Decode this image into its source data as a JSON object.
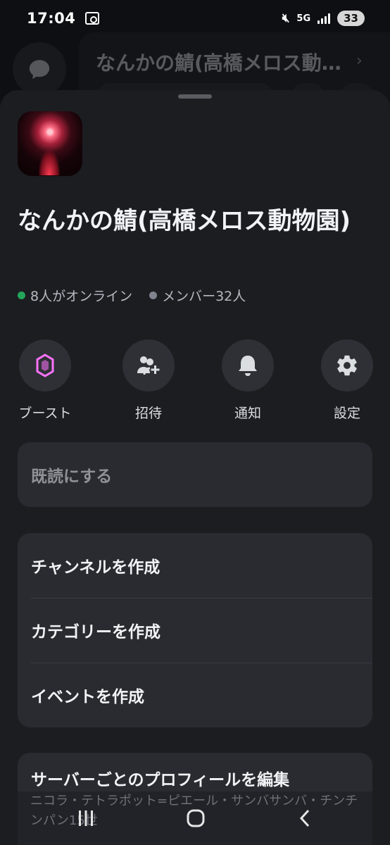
{
  "status_bar": {
    "time": "17:04",
    "network": "5G",
    "battery": "33"
  },
  "background": {
    "title": "なんかの鯖(高橋メロス動物園)",
    "title_display": "なんかの鯖(高橋メロス動…"
  },
  "server": {
    "name": "なんかの鯖(高橋メロス動物園)",
    "online": "8人がオンライン",
    "members": "メンバー32人"
  },
  "actions": [
    {
      "label": "ブースト",
      "icon": "boost-gem-icon"
    },
    {
      "label": "招待",
      "icon": "add-member-icon"
    },
    {
      "label": "通知",
      "icon": "bell-icon"
    },
    {
      "label": "設定",
      "icon": "gear-icon"
    }
  ],
  "mark_read": {
    "label": "既読にする"
  },
  "create_menu": {
    "items": [
      {
        "label": "チャンネルを作成"
      },
      {
        "label": "カテゴリーを作成"
      },
      {
        "label": "イベントを作成"
      }
    ]
  },
  "profile_card": {
    "label": "サーバーごとのプロフィールを編集",
    "overlay_text": "ニコラ・テトラポット=ピエール・サンバサンバ・チンチンパン15世"
  },
  "navigation": {
    "recent_apps": "recent-apps-icon",
    "home": "home-icon",
    "back": "back-icon"
  },
  "colors": {
    "sheet_background": "#1c1d21",
    "card_background": "#2a2b31",
    "online_dot": "#23a55a",
    "boost_accent": "#ff73fa"
  }
}
